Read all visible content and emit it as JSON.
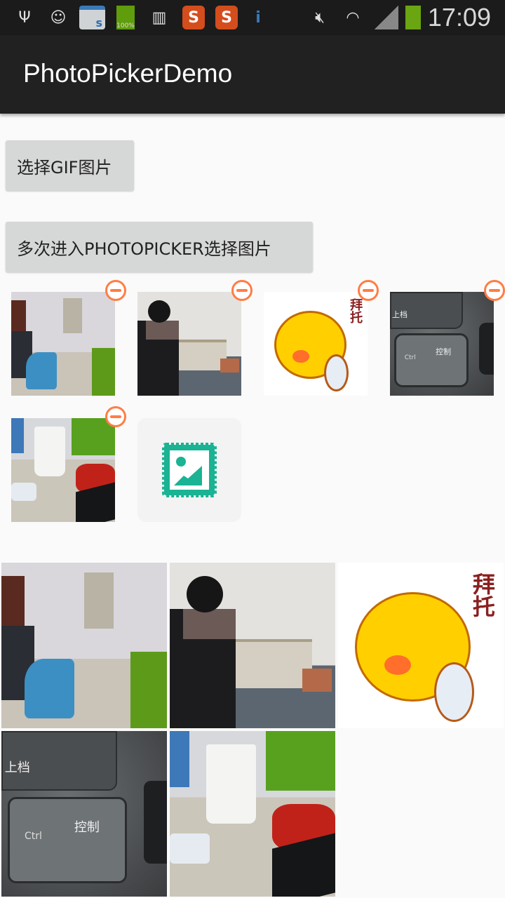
{
  "status_bar": {
    "time": "17:09",
    "battery_notification_text": "100%",
    "icons": [
      "usb-icon",
      "incognito-icon",
      "store-icon",
      "battery-full-icon",
      "sim-missing-icon",
      "sogou-icon",
      "sogou-icon",
      "info-icon",
      "mute-icon",
      "wifi-icon",
      "signal-icon",
      "battery-icon"
    ]
  },
  "app_bar": {
    "title": "PhotoPickerDemo"
  },
  "buttons": {
    "pick_gif": "选择GIF图片",
    "multi_pick": "多次进入PHOTOPICKER选择图片"
  },
  "selected_thumbnails": [
    "office-wall",
    "person-at-desk",
    "cartoon-baituo",
    "keyboard-ctrl",
    "mug-desk"
  ],
  "cartoon_text": "拜托",
  "keyboard_text": {
    "shift": "上档",
    "ctrl": "Ctrl",
    "ctrl_cn": "控制"
  },
  "colors": {
    "accent": "#ff7d45",
    "add_icon": "#1ab394",
    "app_bar": "#212121"
  }
}
